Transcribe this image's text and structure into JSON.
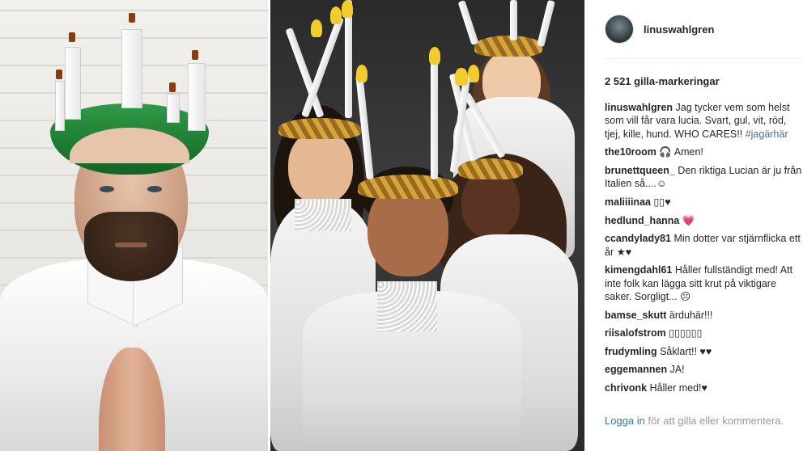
{
  "post": {
    "username": "linuswahlgren",
    "likes": "2 521 gilla-markeringar",
    "caption_user": "linuswahlgren",
    "caption_text": "Jag tycker vem som helst som vill får vara lucia. Svart, gul, vit, röd, tjej, kille, hund. WHO CARES!!",
    "caption_hashtag": "#jagärhär"
  },
  "comments": [
    {
      "user": "the10room",
      "text": "🎧 Amen!"
    },
    {
      "user": "brunettqueen_",
      "text": "Den riktiga Lucian är ju från Italien så....☺"
    },
    {
      "user": "maliiiinaa",
      "text": "▯▯♥"
    },
    {
      "user": "hedlund_hanna",
      "text": "💗"
    },
    {
      "user": "ccandylady81",
      "text": "Min dotter var stjärnflicka ett år ★♥"
    },
    {
      "user": "kimengdahl61",
      "text": "Håller fullständigt med! Att inte folk kan lägga sitt krut på viktigare saker. Sorgligt... ☹"
    },
    {
      "user": "bamse_skutt",
      "text": "ärduhär!!!"
    },
    {
      "user": "riisalofstrom",
      "text": "▯▯▯▯▯▯"
    },
    {
      "user": "frudymling",
      "text": "Såklart!! ♥♥"
    },
    {
      "user": "eggemannen",
      "text": "JA!"
    },
    {
      "user": "chrivonk",
      "text": "Håller med!♥"
    }
  ],
  "footer": {
    "login_label": "Logga in",
    "rest": "för att gilla eller kommentera."
  },
  "colors": {
    "link": "#3f729b",
    "text": "#262626",
    "muted": "#999999",
    "crown_green": "#1f7a33",
    "flame_yellow": "#f1cc2c"
  },
  "icons": [
    "avatar"
  ]
}
